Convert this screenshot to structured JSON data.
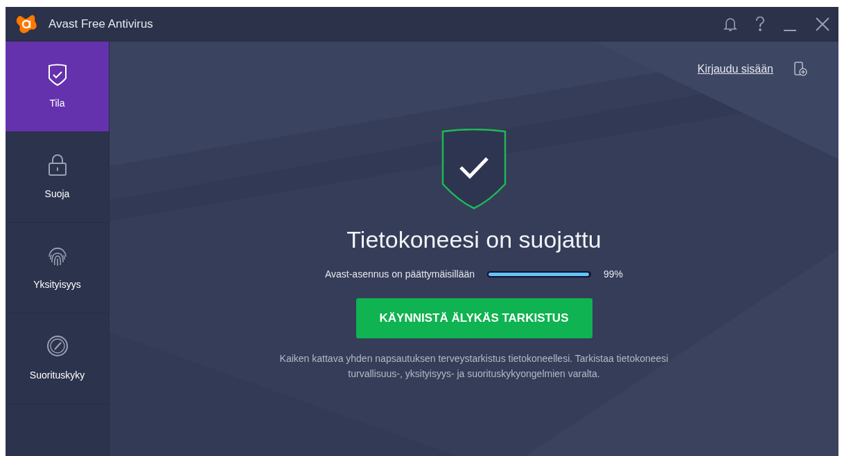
{
  "window": {
    "title": "Avast Free Antivirus"
  },
  "sidebar": {
    "items": [
      {
        "label": "Tila",
        "selected": true
      },
      {
        "label": "Suoja",
        "selected": false
      },
      {
        "label": "Yksityisyys",
        "selected": false
      },
      {
        "label": "Suorituskyky",
        "selected": false
      }
    ]
  },
  "header": {
    "sign_in": "Kirjaudu sisään"
  },
  "status": {
    "title": "Tietokoneesi on suojattu",
    "progress": {
      "label": "Avast-asennus on päättymäisillään",
      "level": 0.99,
      "reading": "99%"
    },
    "button": "KÄYNNISTÄ ÄLYKÄS TARKISTUS",
    "description": "Kaiken kattava yhden napsautuksen terveystarkistus tietokoneellesi. Tarkistaa tietokoneesi turvallisuus-, yksityisyys- ja suorituskykyongelmien varalta."
  }
}
